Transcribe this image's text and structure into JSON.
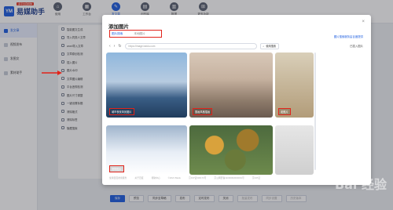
{
  "app": {
    "logo_mark": "YM",
    "logo_text": "易媒助手",
    "logo_tag": "多平台自媒体"
  },
  "nav": [
    {
      "label": "使用",
      "icon": "home-icon"
    },
    {
      "label": "工作台",
      "icon": "workbench-icon"
    },
    {
      "label": "发文章",
      "icon": "edit-icon",
      "active": true
    },
    {
      "label": "创作库",
      "icon": "library-icon"
    },
    {
      "label": "数据",
      "icon": "chart-icon"
    },
    {
      "label": "更多功能",
      "icon": "grid-icon"
    }
  ],
  "sidebar": [
    {
      "label": "发文章",
      "active": true
    },
    {
      "label": "视频发布"
    },
    {
      "label": "发图文"
    },
    {
      "label": "素材助手"
    }
  ],
  "tools": [
    "智能图文生成",
    "导入同类人文章",
    "word导入文章",
    "文章原创检测",
    "插入图片",
    "图片水印",
    "文章图片编辑",
    "平台违规检测",
    "图片尺寸调整",
    "一键设置标题",
    "清除格式",
    "清除标签",
    "隐藏搜索"
  ],
  "dialog": {
    "title": "添加图片",
    "close": "×",
    "tabs": [
      {
        "label": "图片搜索",
        "active": true
      },
      {
        "label": "本地图片"
      }
    ],
    "right_link": "图片搜索服务由百度提供",
    "right_option": "已插入图片",
    "search_placeholder": "https://image.baidu.com",
    "search_button": "使用搜索",
    "tiles": [
      {
        "label": "城市夜景风景图片"
      },
      {
        "label": "国画风格插画"
      },
      {
        "label": "老照片"
      },
      {
        "label": "宠物图片"
      },
      {
        "label": "",
        "hidden": true
      },
      {
        "label": "",
        "hidden": true
      }
    ],
    "footer": [
      "使用百度搜索服务",
      "关于百度",
      "帮助中心",
      "©2021 Baidu",
      "京ICP证030173号",
      "京公网安备11000002000001号",
      "京ICP证"
    ]
  },
  "bottombar": [
    {
      "label": "保存",
      "primary": true
    },
    {
      "label": "预览"
    },
    {
      "label": "同步至草稿"
    },
    {
      "label": "发布"
    },
    {
      "label": "定时发布"
    },
    {
      "label": "关闭"
    },
    {
      "label": "批量发布",
      "muted": true
    },
    {
      "label": "同步设置",
      "muted": true
    },
    {
      "label": "历史版本",
      "muted": true
    }
  ],
  "watermark": "Bai 经验"
}
